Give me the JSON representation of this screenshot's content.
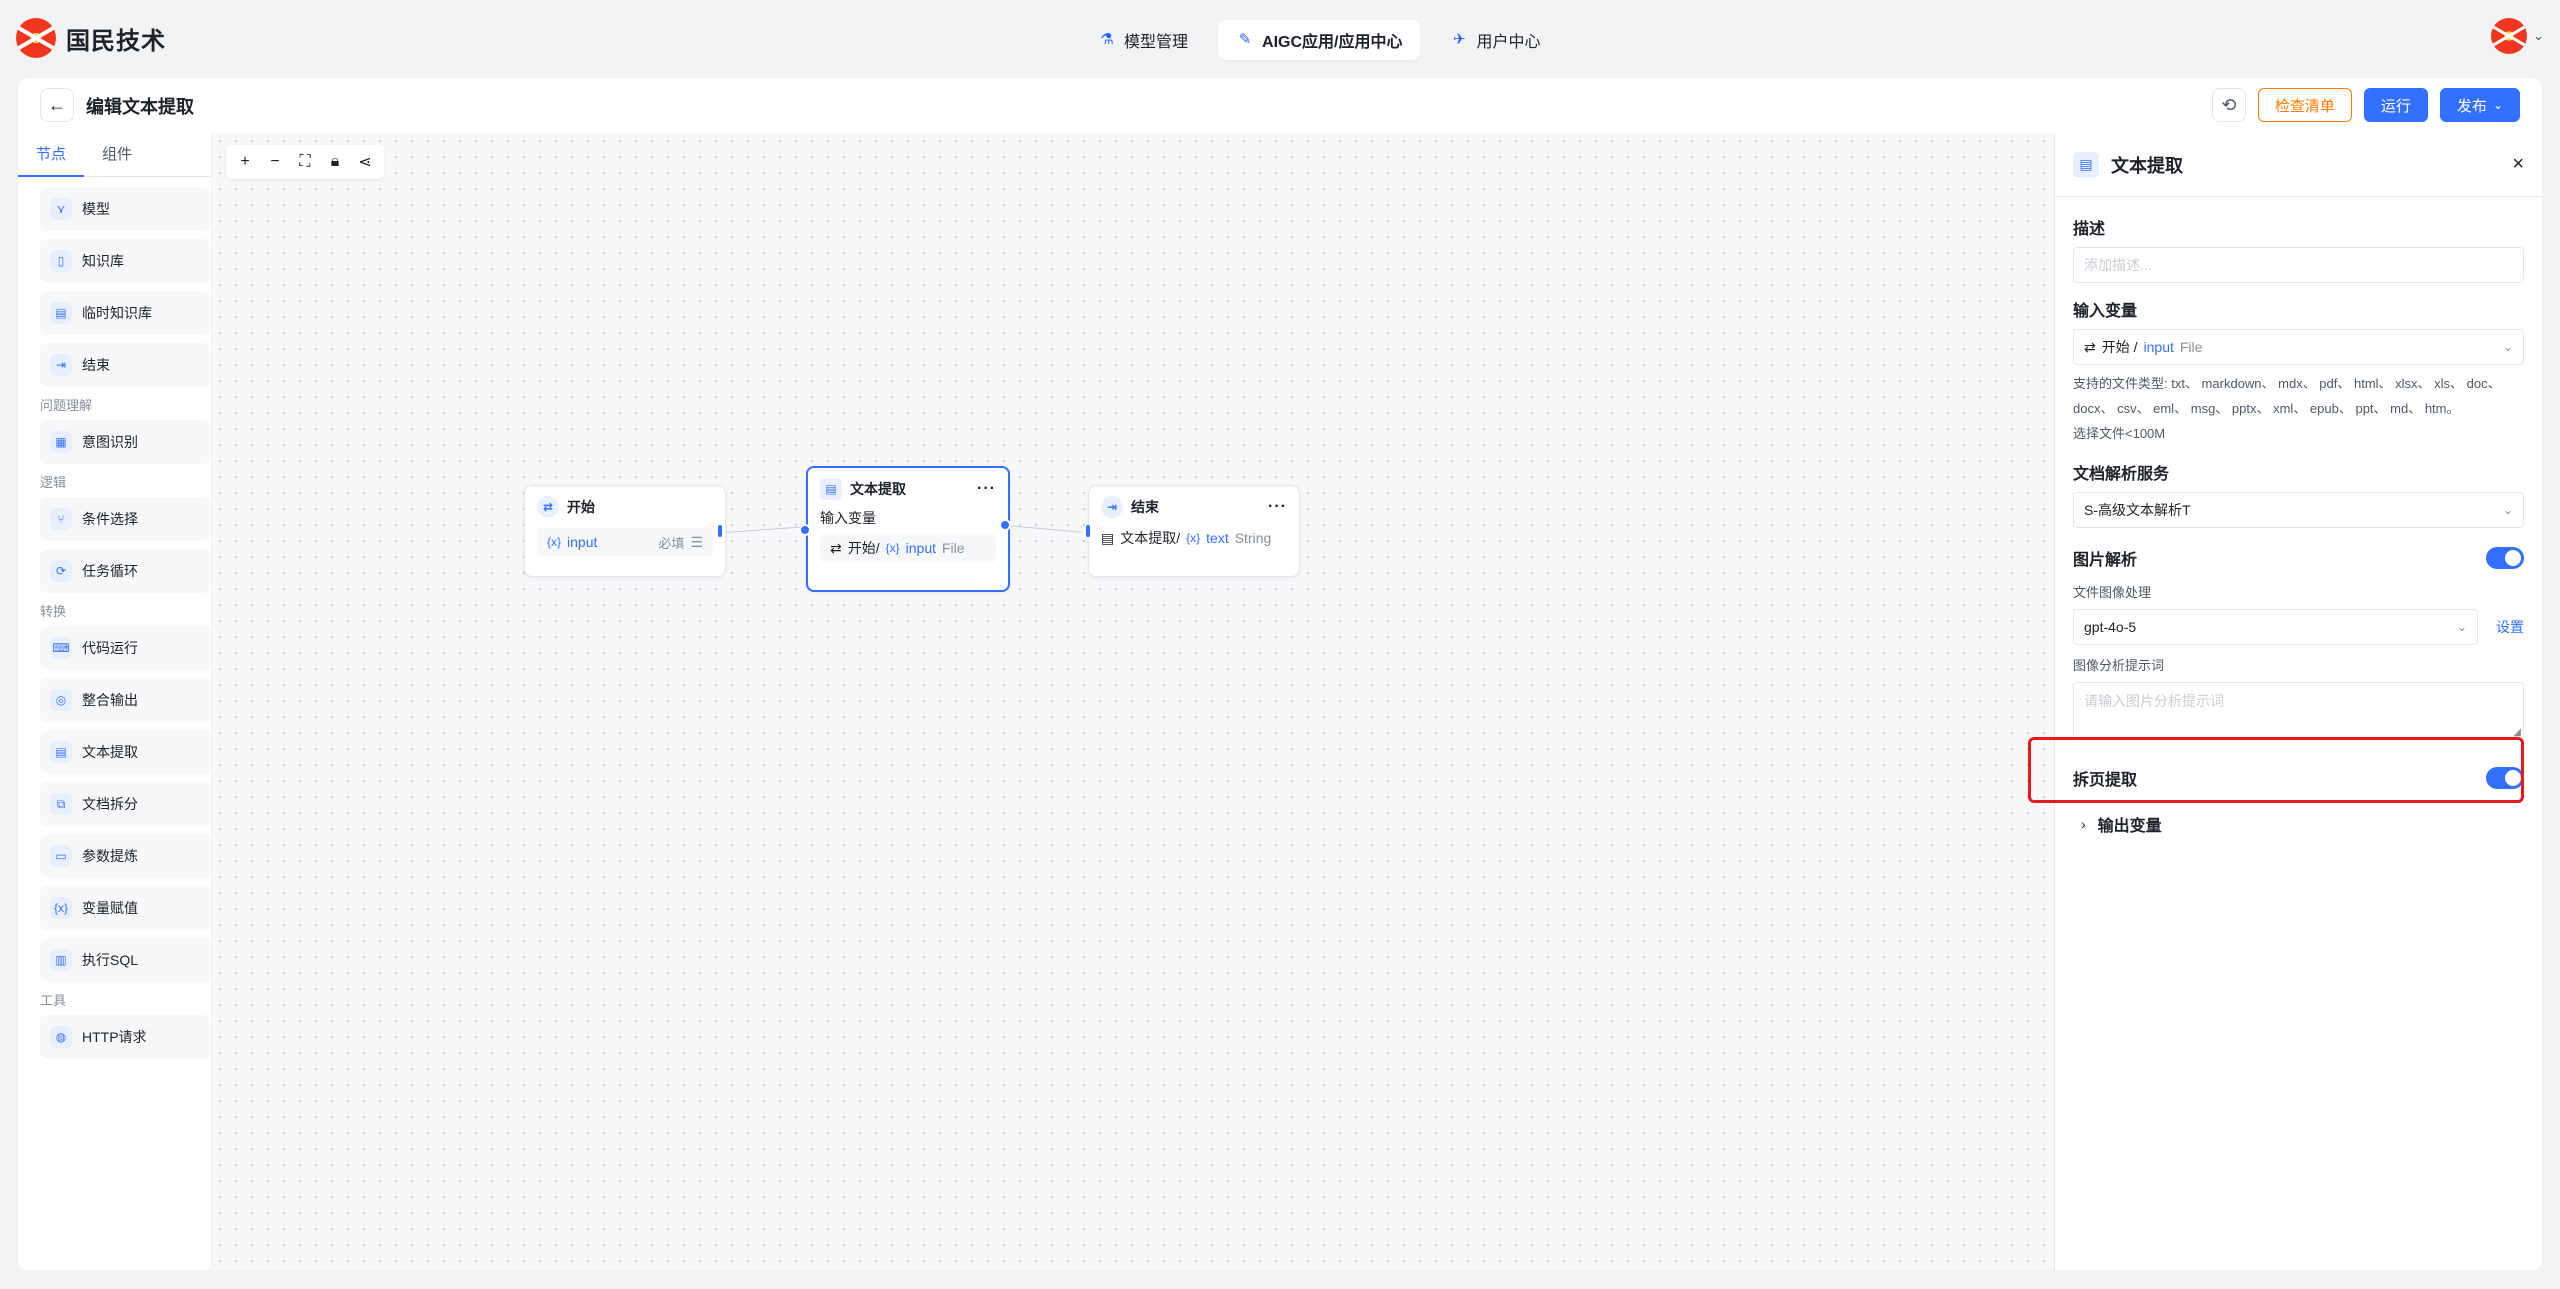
{
  "brand": {
    "name": "国民技术"
  },
  "nav": [
    {
      "label": "模型管理",
      "icon": "model-icon",
      "active": false
    },
    {
      "label": "AIGC应用/应用中心",
      "icon": "app-icon",
      "active": true
    },
    {
      "label": "用户中心",
      "icon": "user-icon",
      "active": false
    }
  ],
  "header": {
    "title": "编辑文本提取",
    "check_label": "检查清单",
    "run_label": "运行",
    "publish_label": "发布"
  },
  "left": {
    "tabs": [
      "节点",
      "组件"
    ],
    "groups": [
      {
        "label": "",
        "items": [
          "模型",
          "知识库",
          "临时知识库",
          "结束"
        ]
      },
      {
        "label": "问题理解",
        "items": [
          "意图识别"
        ]
      },
      {
        "label": "逻辑",
        "items": [
          "条件选择",
          "任务循环"
        ]
      },
      {
        "label": "转换",
        "items": [
          "代码运行",
          "整合输出",
          "文本提取",
          "文档拆分",
          "参数提炼",
          "变量赋值",
          "执行SQL"
        ]
      },
      {
        "label": "工具",
        "items": [
          "HTTP请求"
        ]
      }
    ]
  },
  "canvas": {
    "start": {
      "title": "开始",
      "var": "input",
      "required": "必填"
    },
    "extract": {
      "title": "文本提取",
      "section": "输入变量",
      "src": "开始/",
      "var": "input",
      "type": "File"
    },
    "end": {
      "title": "结束",
      "src": "文本提取/",
      "var": "text",
      "type": "String"
    }
  },
  "panel": {
    "title": "文本提取",
    "desc_label": "描述",
    "desc_placeholder": "添加描述...",
    "input_label": "输入变量",
    "input_src": "开始 /",
    "input_var": "input",
    "input_type": "File",
    "hint1": "支持的文件类型: txt、 markdown、 mdx、 pdf、 html、 xlsx、 xls、 doc、",
    "hint2": "docx、 csv、 eml、 msg、 pptx、 xml、 epub、 ppt、 md、 htm。",
    "hint3": "选择文件<100M",
    "parse_label": "文档解析服务",
    "parse_value": "S-高级文本解析T",
    "image_label": "图片解析",
    "image_proc_label": "文件图像处理",
    "image_model": "gpt-4o-5",
    "setting_label": "设置",
    "prompt_label": "图像分析提示词",
    "prompt_placeholder": "请输入图片分析提示词",
    "split_label": "拆页提取",
    "output_label": "输出变量"
  },
  "colors": {
    "accent": "#3370ff",
    "warning": "#ff7d00",
    "highlight": "#e8191c"
  }
}
